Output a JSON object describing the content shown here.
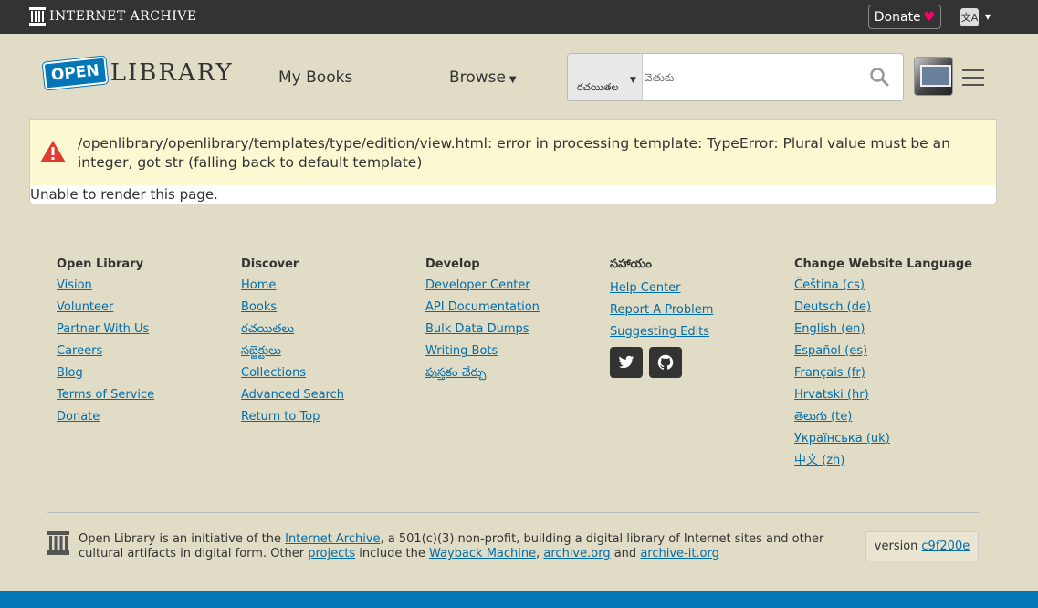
{
  "ia_bar": {
    "logo_text": "INTERNET ARCHIVE",
    "donate_label": "Donate",
    "donate_heart": "♥",
    "language_caret": "▾"
  },
  "header": {
    "logo_open": "OPEN",
    "logo_library": "LIBRARY",
    "nav_mybooks": "My Books",
    "nav_browse": "Browse",
    "search_facet": "రచయితల",
    "search_placeholder": "వెతుకు"
  },
  "main": {
    "error_message": "/openlibrary/openlibrary/templates/type/edition/view.html: error in processing template: TypeError: Plural value must be an integer, got str (falling back to default template)",
    "unable_text": "Unable to render this page."
  },
  "footer": {
    "columns": [
      {
        "heading": "Open Library",
        "links": [
          "Vision",
          "Volunteer",
          "Partner With Us",
          "Careers",
          "Blog",
          "Terms of Service",
          "Donate"
        ]
      },
      {
        "heading": "Discover",
        "links": [
          "Home",
          "Books",
          "రచయితలు",
          "సబ్జెక్టులు",
          "Collections",
          "Advanced Search",
          "Return to Top"
        ]
      },
      {
        "heading": "Develop",
        "links": [
          "Developer Center",
          "API Documentation",
          "Bulk Data Dumps",
          "Writing Bots",
          "పుస్తకం చేర్చు"
        ]
      },
      {
        "heading": "సహాయం",
        "links": [
          "Help Center",
          "Report A Problem",
          "Suggesting Edits"
        ]
      },
      {
        "heading": "Change Website Language",
        "links": [
          "Čeština (cs)",
          "Deutsch (de)",
          "English (en)",
          "Español (es)",
          "Français (fr)",
          "Hrvatski (hr)",
          "తెలుగు (te)",
          "Українська (uk)",
          "中文 (zh)"
        ]
      }
    ],
    "about": {
      "t1": "Open Library is an initiative of the ",
      "l1": "Internet Archive",
      "t2": ", a 501(c)(3) non-profit, building a digital library of Internet sites and other cultural artifacts in digital form. Other ",
      "l2": "projects",
      "t3": " include the ",
      "l3": "Wayback Machine",
      "t4": ", ",
      "l4": "archive.org",
      "t5": " and ",
      "l5": "archive-it.org"
    },
    "version_label": "version",
    "version_hash": "c9f200e"
  },
  "colors": {
    "brand_blue": "#0376b8",
    "link": "#036daa",
    "alert_bg": "#fcf8d2",
    "page_bg": "#e1dcc5"
  }
}
